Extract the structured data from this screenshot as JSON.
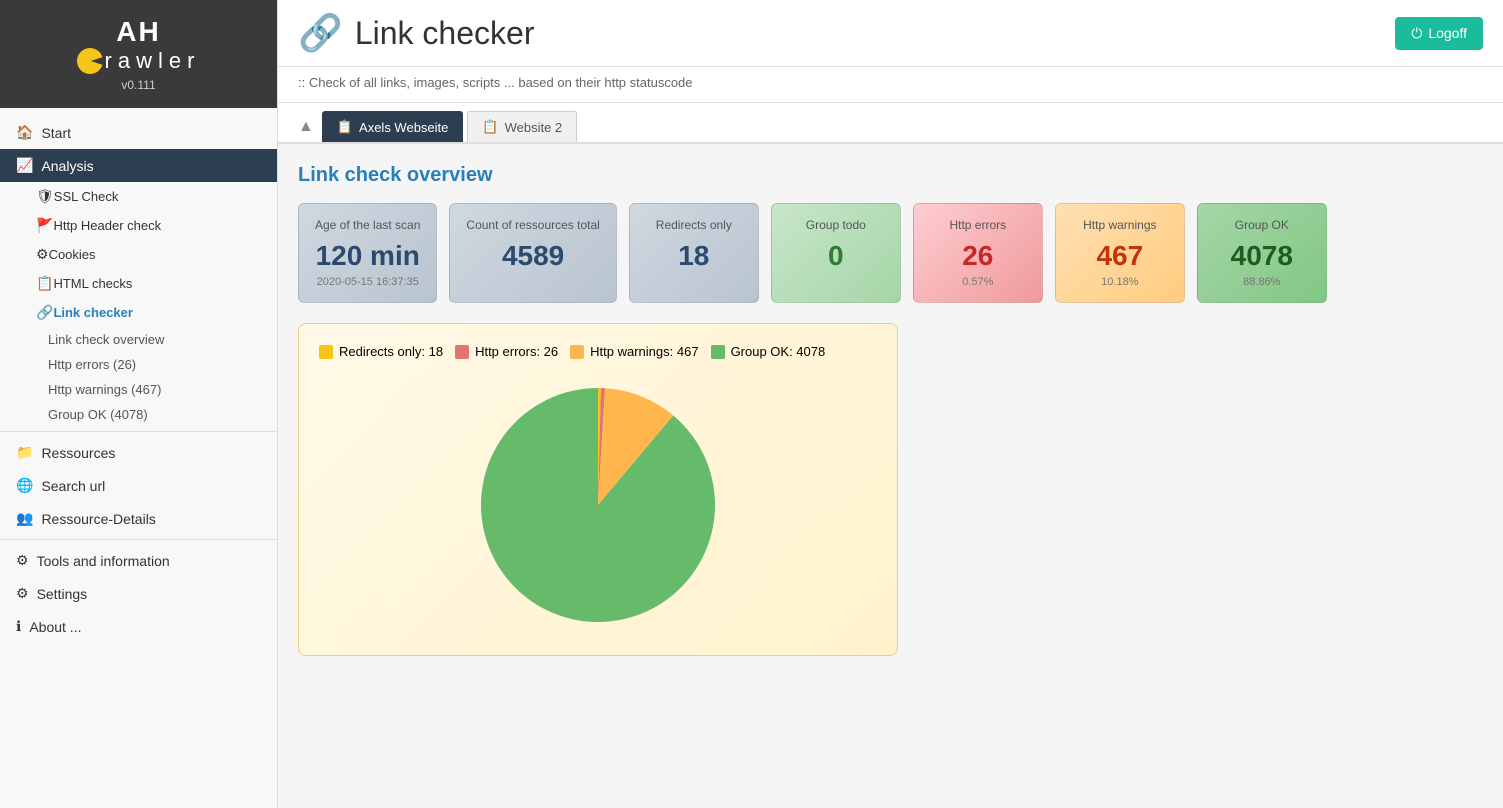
{
  "app": {
    "logo_letters": "AH",
    "logo_crawler": "rawler",
    "version": "v0.111",
    "title": "Link checker",
    "subtitle": ":: Check of all links, images, scripts ... based on their http statuscode",
    "logoff_label": "Logoff"
  },
  "sidebar": {
    "items": [
      {
        "id": "start",
        "label": "Start",
        "icon": "🏠"
      },
      {
        "id": "analysis",
        "label": "Analysis",
        "icon": "📈",
        "active": true
      },
      {
        "id": "ssl-check",
        "label": "SSL Check",
        "icon": "🛡",
        "sub": true
      },
      {
        "id": "http-header",
        "label": "Http Header check",
        "icon": "🚩",
        "sub": true
      },
      {
        "id": "cookies",
        "label": "Cookies",
        "icon": "⚙",
        "sub": true
      },
      {
        "id": "html-checks",
        "label": "HTML checks",
        "icon": "📋",
        "sub": true
      },
      {
        "id": "link-checker",
        "label": "Link checker",
        "icon": "🔗",
        "sub": true,
        "active_sub": true
      },
      {
        "id": "link-check-overview",
        "label": "Link check overview",
        "subsub": true,
        "active_subsub": true
      },
      {
        "id": "http-errors",
        "label": "Http errors (26)",
        "subsub": true
      },
      {
        "id": "http-warnings",
        "label": "Http warnings (467)",
        "subsub": true
      },
      {
        "id": "group-ok",
        "label": "Group OK (4078)",
        "subsub": true
      }
    ],
    "resources": {
      "label": "Ressources",
      "icon": "📁"
    },
    "search_url": {
      "label": "Search url",
      "icon": "🌐"
    },
    "resource_details": {
      "label": "Ressource-Details",
      "icon": "👥"
    },
    "tools": {
      "label": "Tools and information",
      "icon": "⚙"
    },
    "settings": {
      "label": "Settings",
      "icon": "⚙"
    },
    "about": {
      "label": "About ...",
      "icon": "ℹ"
    }
  },
  "tabs": [
    {
      "id": "tab1",
      "label": "Axels Webseite",
      "icon": "📋",
      "active": true
    },
    {
      "id": "tab2",
      "label": "Website 2",
      "icon": "📋"
    }
  ],
  "overview": {
    "title": "Link check overview",
    "cards": [
      {
        "id": "age",
        "label": "Age of the last scan",
        "value": "120 min",
        "sub": "2020-05-15 16:37:35",
        "style": "grey"
      },
      {
        "id": "total",
        "label": "Count of ressources total",
        "value": "4589",
        "sub": "",
        "style": "grey"
      },
      {
        "id": "redirects",
        "label": "Redirects only",
        "value": "18",
        "sub": "",
        "style": "grey"
      },
      {
        "id": "todo",
        "label": "Group todo",
        "value": "0",
        "sub": "",
        "style": "green-light"
      },
      {
        "id": "http-errors",
        "label": "Http errors",
        "value": "26",
        "sub": "0.57%",
        "style": "red"
      },
      {
        "id": "http-warnings",
        "label": "Http warnings",
        "value": "467",
        "sub": "10.18%",
        "style": "orange"
      },
      {
        "id": "group-ok",
        "label": "Group OK",
        "value": "4078",
        "sub": "88.86%",
        "style": "green-dark"
      }
    ]
  },
  "chart": {
    "legend": [
      {
        "label": "Redirects only: 18",
        "color": "#f5c518"
      },
      {
        "label": "Http errors: 26",
        "color": "#e57373"
      },
      {
        "label": "Http warnings: 467",
        "color": "#ffb74d"
      },
      {
        "label": "Group OK: 4078",
        "color": "#66bb6a"
      }
    ],
    "segments": [
      {
        "label": "Redirects only",
        "value": 18,
        "color": "#f5c518"
      },
      {
        "label": "Http errors",
        "value": 26,
        "color": "#e57373"
      },
      {
        "label": "Http warnings",
        "value": 467,
        "color": "#ffb74d"
      },
      {
        "label": "Group OK",
        "value": 4078,
        "color": "#66bb6a"
      }
    ],
    "total": 4589
  }
}
